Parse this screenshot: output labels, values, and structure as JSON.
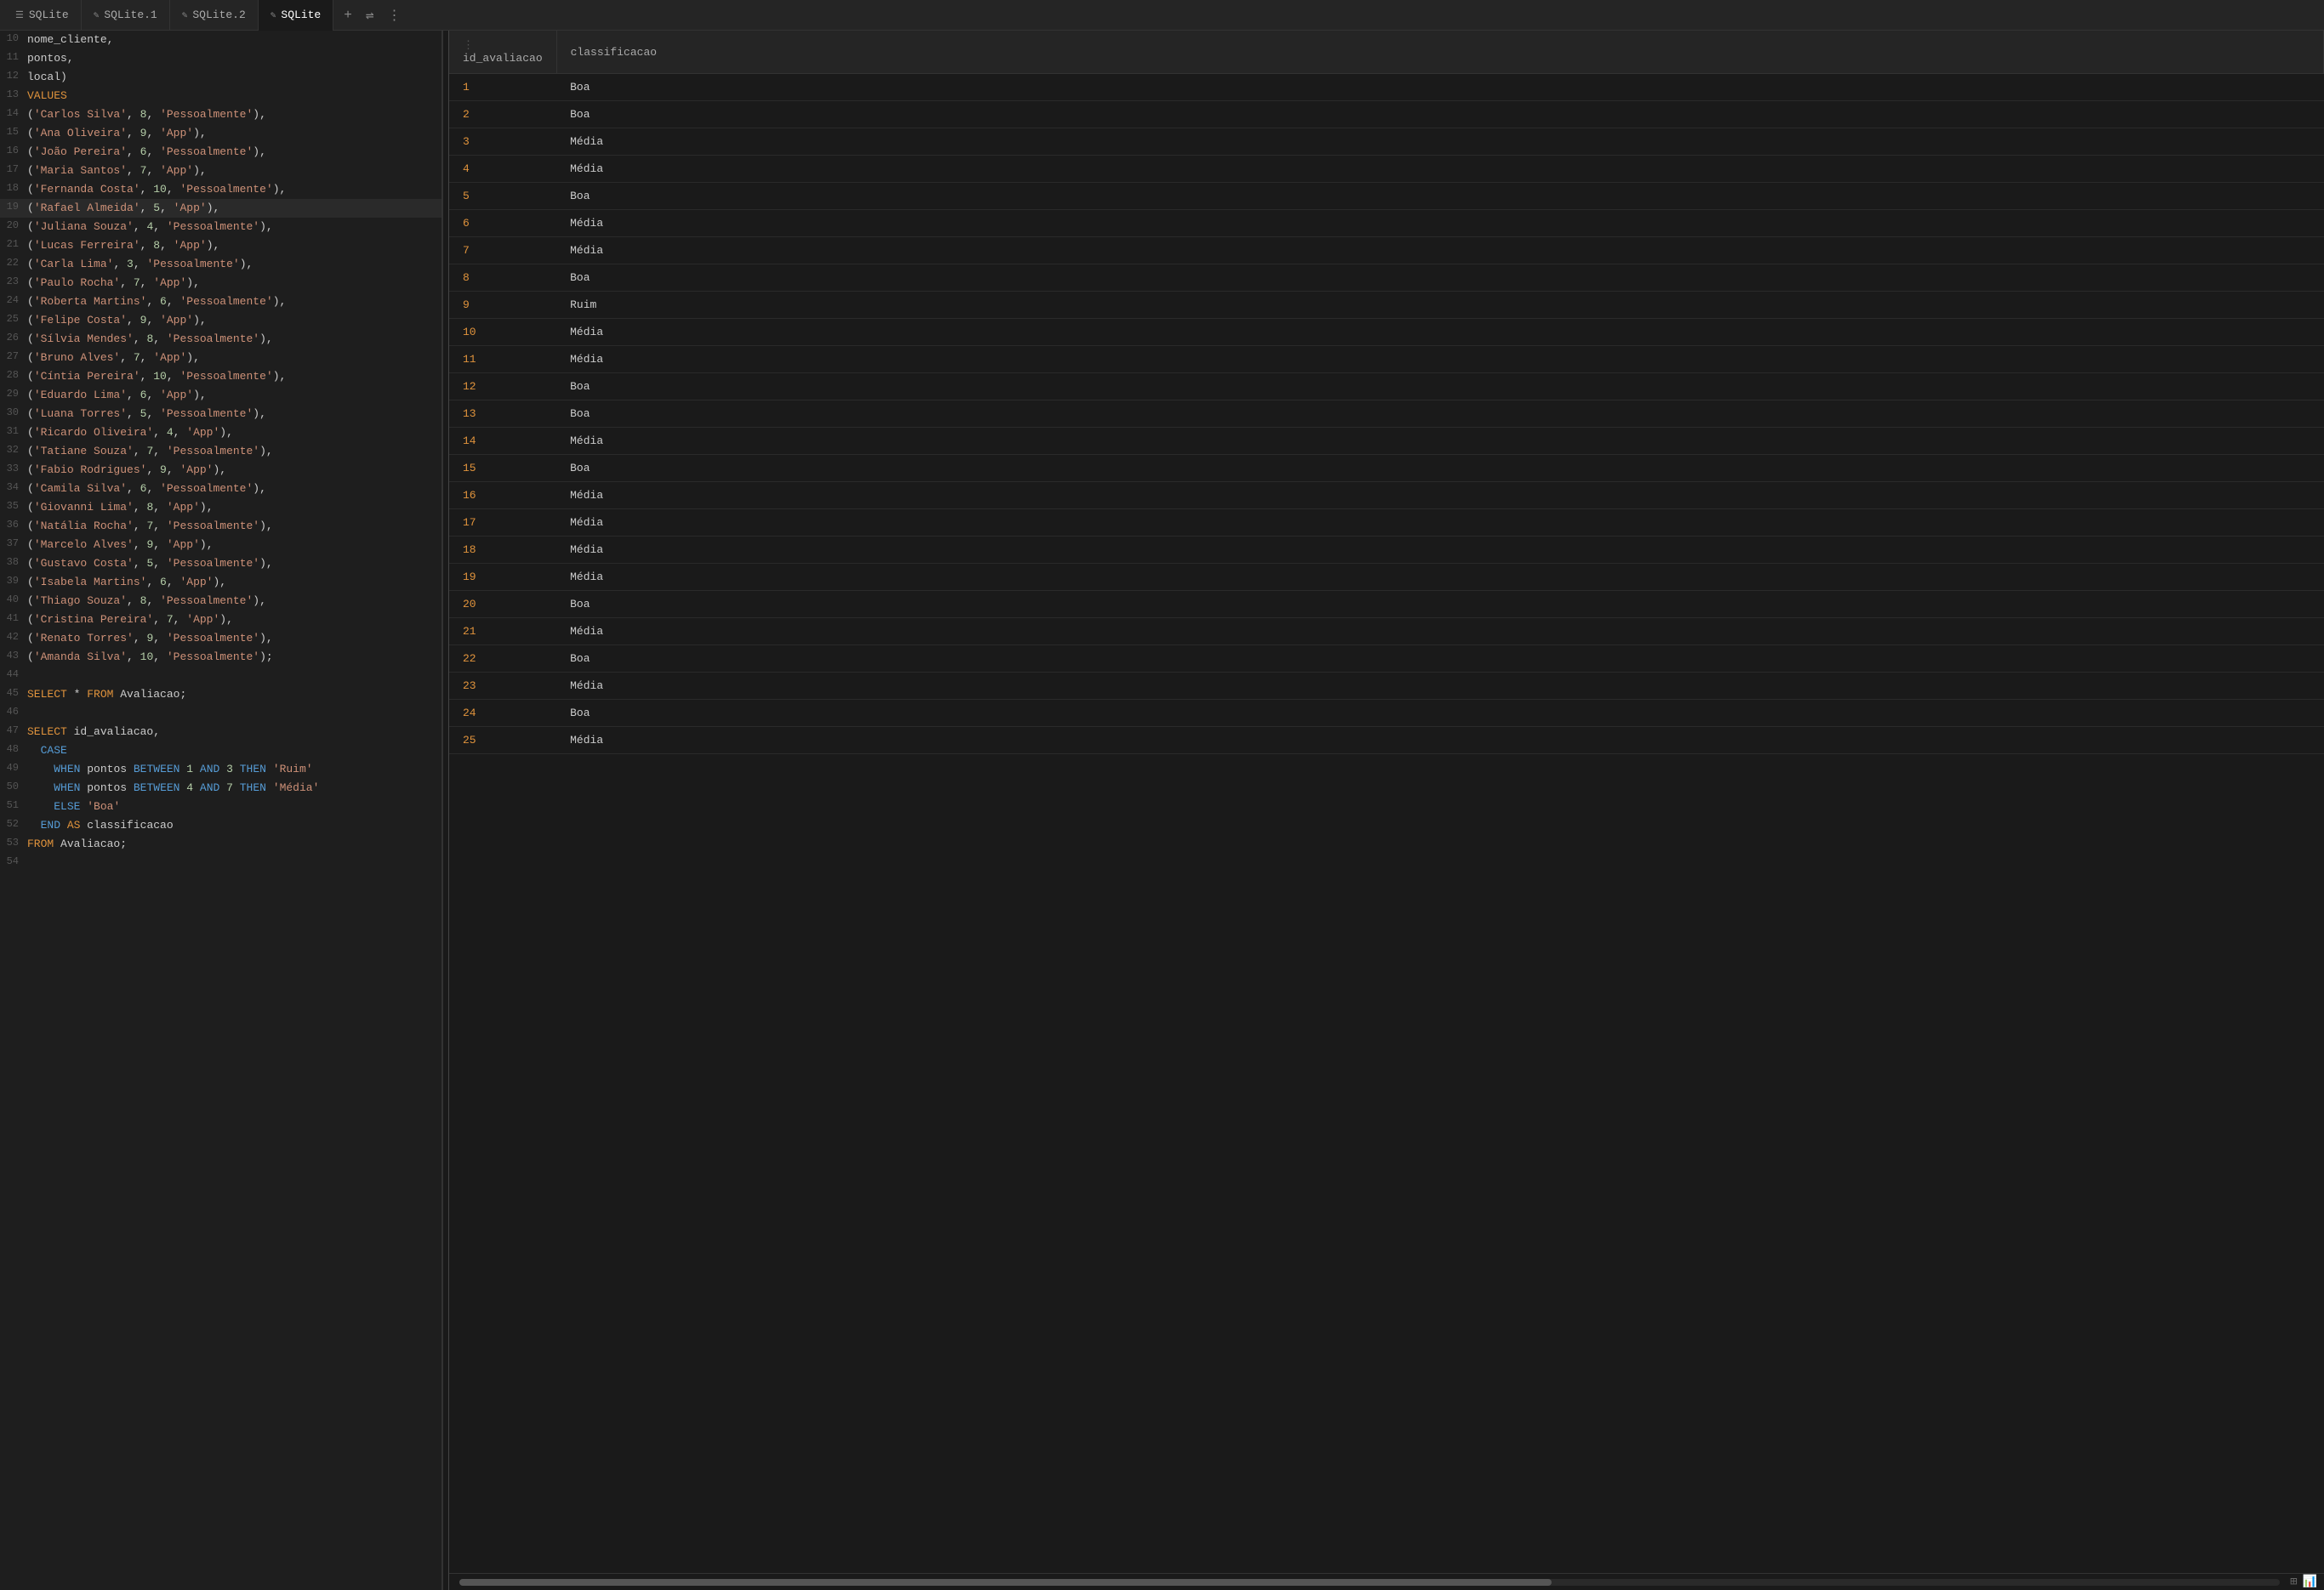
{
  "tabs": [
    {
      "id": "sqlite-main",
      "label": "SQLite",
      "icon": "☰",
      "active": false,
      "modified": false
    },
    {
      "id": "sqlite-1",
      "label": "SQLite.1",
      "icon": "✎",
      "active": false,
      "modified": true
    },
    {
      "id": "sqlite-2",
      "label": "SQLite.2",
      "icon": "✎",
      "active": false,
      "modified": true
    },
    {
      "id": "sqlite-active",
      "label": "SQLite",
      "icon": "✎",
      "active": true,
      "modified": true
    }
  ],
  "tab_actions": [
    "+",
    "⇌",
    "⋮"
  ],
  "code_lines": [
    {
      "n": "10",
      "text": "nome_cliente,",
      "type": "plain"
    },
    {
      "n": "11",
      "text": "pontos,",
      "type": "plain"
    },
    {
      "n": "12",
      "text": "local)",
      "type": "plain"
    },
    {
      "n": "13",
      "text": "VALUES",
      "type": "keyword"
    },
    {
      "n": "14",
      "text": "('Carlos Silva', 8, 'Pessoalmente'),",
      "type": "mixed"
    },
    {
      "n": "15",
      "text": "('Ana Oliveira', 9, 'App'),",
      "type": "mixed"
    },
    {
      "n": "16",
      "text": "('João Pereira', 6, 'Pessoalmente'),",
      "type": "mixed"
    },
    {
      "n": "17",
      "text": "('Maria Santos', 7, 'App'),",
      "type": "mixed"
    },
    {
      "n": "18",
      "text": "('Fernanda Costa', 10, 'Pessoalmente'),",
      "type": "mixed"
    },
    {
      "n": "19",
      "text": "('Rafael Almeida', 5, 'App'),",
      "type": "mixed",
      "highlighted": true
    },
    {
      "n": "20",
      "text": "('Juliana Souza', 4, 'Pessoalmente'),",
      "type": "mixed"
    },
    {
      "n": "21",
      "text": "('Lucas Ferreira', 8, 'App'),",
      "type": "mixed"
    },
    {
      "n": "22",
      "text": "('Carla Lima', 3, 'Pessoalmente'),",
      "type": "mixed"
    },
    {
      "n": "23",
      "text": "('Paulo Rocha', 7, 'App'),",
      "type": "mixed"
    },
    {
      "n": "24",
      "text": "('Roberta Martins', 6, 'Pessoalmente'),",
      "type": "mixed"
    },
    {
      "n": "25",
      "text": "('Felipe Costa', 9, 'App'),",
      "type": "mixed"
    },
    {
      "n": "26",
      "text": "('Sílvia Mendes', 8, 'Pessoalmente'),",
      "type": "mixed"
    },
    {
      "n": "27",
      "text": "('Bruno Alves', 7, 'App'),",
      "type": "mixed"
    },
    {
      "n": "28",
      "text": "('Cíntia Pereira', 10, 'Pessoalmente'),",
      "type": "mixed"
    },
    {
      "n": "29",
      "text": "('Eduardo Lima', 6, 'App'),",
      "type": "mixed"
    },
    {
      "n": "30",
      "text": "('Luana Torres', 5, 'Pessoalmente'),",
      "type": "mixed"
    },
    {
      "n": "31",
      "text": "('Ricardo Oliveira', 4, 'App'),",
      "type": "mixed"
    },
    {
      "n": "32",
      "text": "('Tatiane Souza', 7, 'Pessoalmente'),",
      "type": "mixed"
    },
    {
      "n": "33",
      "text": "('Fabio Rodrigues', 9, 'App'),",
      "type": "mixed"
    },
    {
      "n": "34",
      "text": "('Camila Silva', 6, 'Pessoalmente'),",
      "type": "mixed"
    },
    {
      "n": "35",
      "text": "('Giovanni Lima', 8, 'App'),",
      "type": "mixed"
    },
    {
      "n": "36",
      "text": "('Natália Rocha', 7, 'Pessoalmente'),",
      "type": "mixed"
    },
    {
      "n": "37",
      "text": "('Marcelo Alves', 9, 'App'),",
      "type": "mixed"
    },
    {
      "n": "38",
      "text": "('Gustavo Costa', 5, 'Pessoalmente'),",
      "type": "mixed"
    },
    {
      "n": "39",
      "text": "('Isabela Martins', 6, 'App'),",
      "type": "mixed"
    },
    {
      "n": "40",
      "text": "('Thiago Souza', 8, 'Pessoalmente'),",
      "type": "mixed"
    },
    {
      "n": "41",
      "text": "('Cristina Pereira', 7, 'App'),",
      "type": "mixed"
    },
    {
      "n": "42",
      "text": "('Renato Torres', 9, 'Pessoalmente'),",
      "type": "mixed"
    },
    {
      "n": "43",
      "text": "('Amanda Silva', 10, 'Pessoalmente');",
      "type": "mixed"
    },
    {
      "n": "44",
      "text": "",
      "type": "plain"
    },
    {
      "n": "45",
      "text": "SELECT * FROM Avaliacao;",
      "type": "select_star"
    },
    {
      "n": "46",
      "text": "",
      "type": "plain"
    },
    {
      "n": "47",
      "text": "SELECT id_avaliacao,",
      "type": "select"
    },
    {
      "n": "48",
      "text": "  CASE",
      "type": "case"
    },
    {
      "n": "49",
      "text": "    WHEN pontos BETWEEN 1 AND 3 THEN 'Ruim'",
      "type": "when1"
    },
    {
      "n": "50",
      "text": "    WHEN pontos BETWEEN 4 AND 7 THEN 'Média'",
      "type": "when2"
    },
    {
      "n": "51",
      "text": "    ELSE 'Boa'",
      "type": "else"
    },
    {
      "n": "52",
      "text": "  END AS classificacao",
      "type": "end"
    },
    {
      "n": "53",
      "text": "FROM Avaliacao;",
      "type": "from"
    },
    {
      "n": "54",
      "text": "",
      "type": "plain"
    }
  ],
  "results": {
    "col1_header": "id_avaliacao",
    "col2_header": "classificacao",
    "rows": [
      {
        "id": "1",
        "classificacao": "Boa"
      },
      {
        "id": "2",
        "classificacao": "Boa"
      },
      {
        "id": "3",
        "classificacao": "Média"
      },
      {
        "id": "4",
        "classificacao": "Média"
      },
      {
        "id": "5",
        "classificacao": "Boa"
      },
      {
        "id": "6",
        "classificacao": "Média"
      },
      {
        "id": "7",
        "classificacao": "Média"
      },
      {
        "id": "8",
        "classificacao": "Boa"
      },
      {
        "id": "9",
        "classificacao": "Ruim"
      },
      {
        "id": "10",
        "classificacao": "Média"
      },
      {
        "id": "11",
        "classificacao": "Média"
      },
      {
        "id": "12",
        "classificacao": "Boa"
      },
      {
        "id": "13",
        "classificacao": "Boa"
      },
      {
        "id": "14",
        "classificacao": "Média"
      },
      {
        "id": "15",
        "classificacao": "Boa"
      },
      {
        "id": "16",
        "classificacao": "Média"
      },
      {
        "id": "17",
        "classificacao": "Média"
      },
      {
        "id": "18",
        "classificacao": "Média"
      },
      {
        "id": "19",
        "classificacao": "Média"
      },
      {
        "id": "20",
        "classificacao": "Boa"
      },
      {
        "id": "21",
        "classificacao": "Média"
      },
      {
        "id": "22",
        "classificacao": "Boa"
      },
      {
        "id": "23",
        "classificacao": "Média"
      },
      {
        "id": "24",
        "classificacao": "Boa"
      },
      {
        "id": "25",
        "classificacao": "Média"
      }
    ]
  }
}
